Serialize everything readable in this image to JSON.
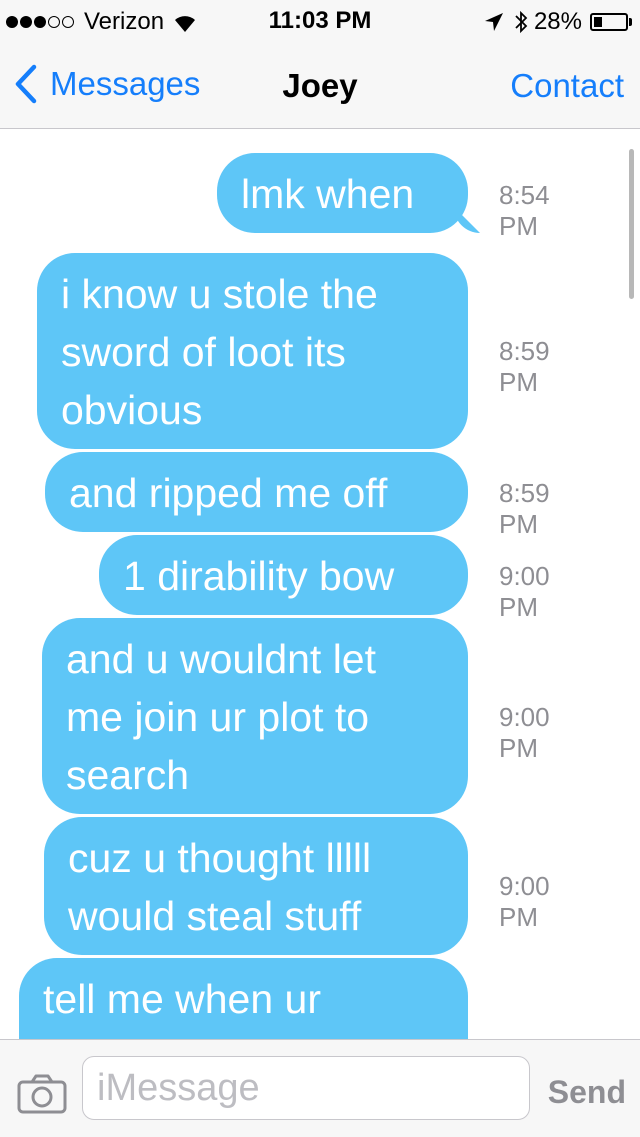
{
  "status_bar": {
    "signal_bars": 3,
    "signal_total": 5,
    "carrier": "Verizon",
    "time": "11:03 PM",
    "battery_percent": "28%",
    "battery_level": 0.28
  },
  "nav": {
    "back_label": "Messages",
    "title": "Joey",
    "contact_label": "Contact"
  },
  "messages": [
    {
      "text": "lmk when",
      "time": "8:54 PM"
    },
    {
      "text": "i know u stole the\nsword of loot its\nobvious",
      "time": "8:59 PM"
    },
    {
      "text": "and ripped me off",
      "time": "8:59 PM"
    },
    {
      "text": "1 dirability bow",
      "time": "9:00 PM"
    },
    {
      "text": "and u wouldnt let\nme join ur plot to\nsearch",
      "time": "9:00 PM"
    },
    {
      "text": "cuz u thought lllll\nwould steal stuff",
      "time": "9:00 PM"
    },
    {
      "text": "tell me when ur",
      "time": ""
    }
  ],
  "input": {
    "placeholder": "iMessage",
    "value": "",
    "send_label": "Send"
  },
  "icons": {
    "back": "chevron-left-icon",
    "camera": "camera-icon",
    "location": "location-arrow-icon",
    "bluetooth": "bluetooth-icon",
    "wifi": "wifi-icon",
    "battery": "battery-icon"
  },
  "colors": {
    "accent": "#157efb",
    "bubble": "#5ec6f7",
    "timestamp": "#8e8e93"
  }
}
